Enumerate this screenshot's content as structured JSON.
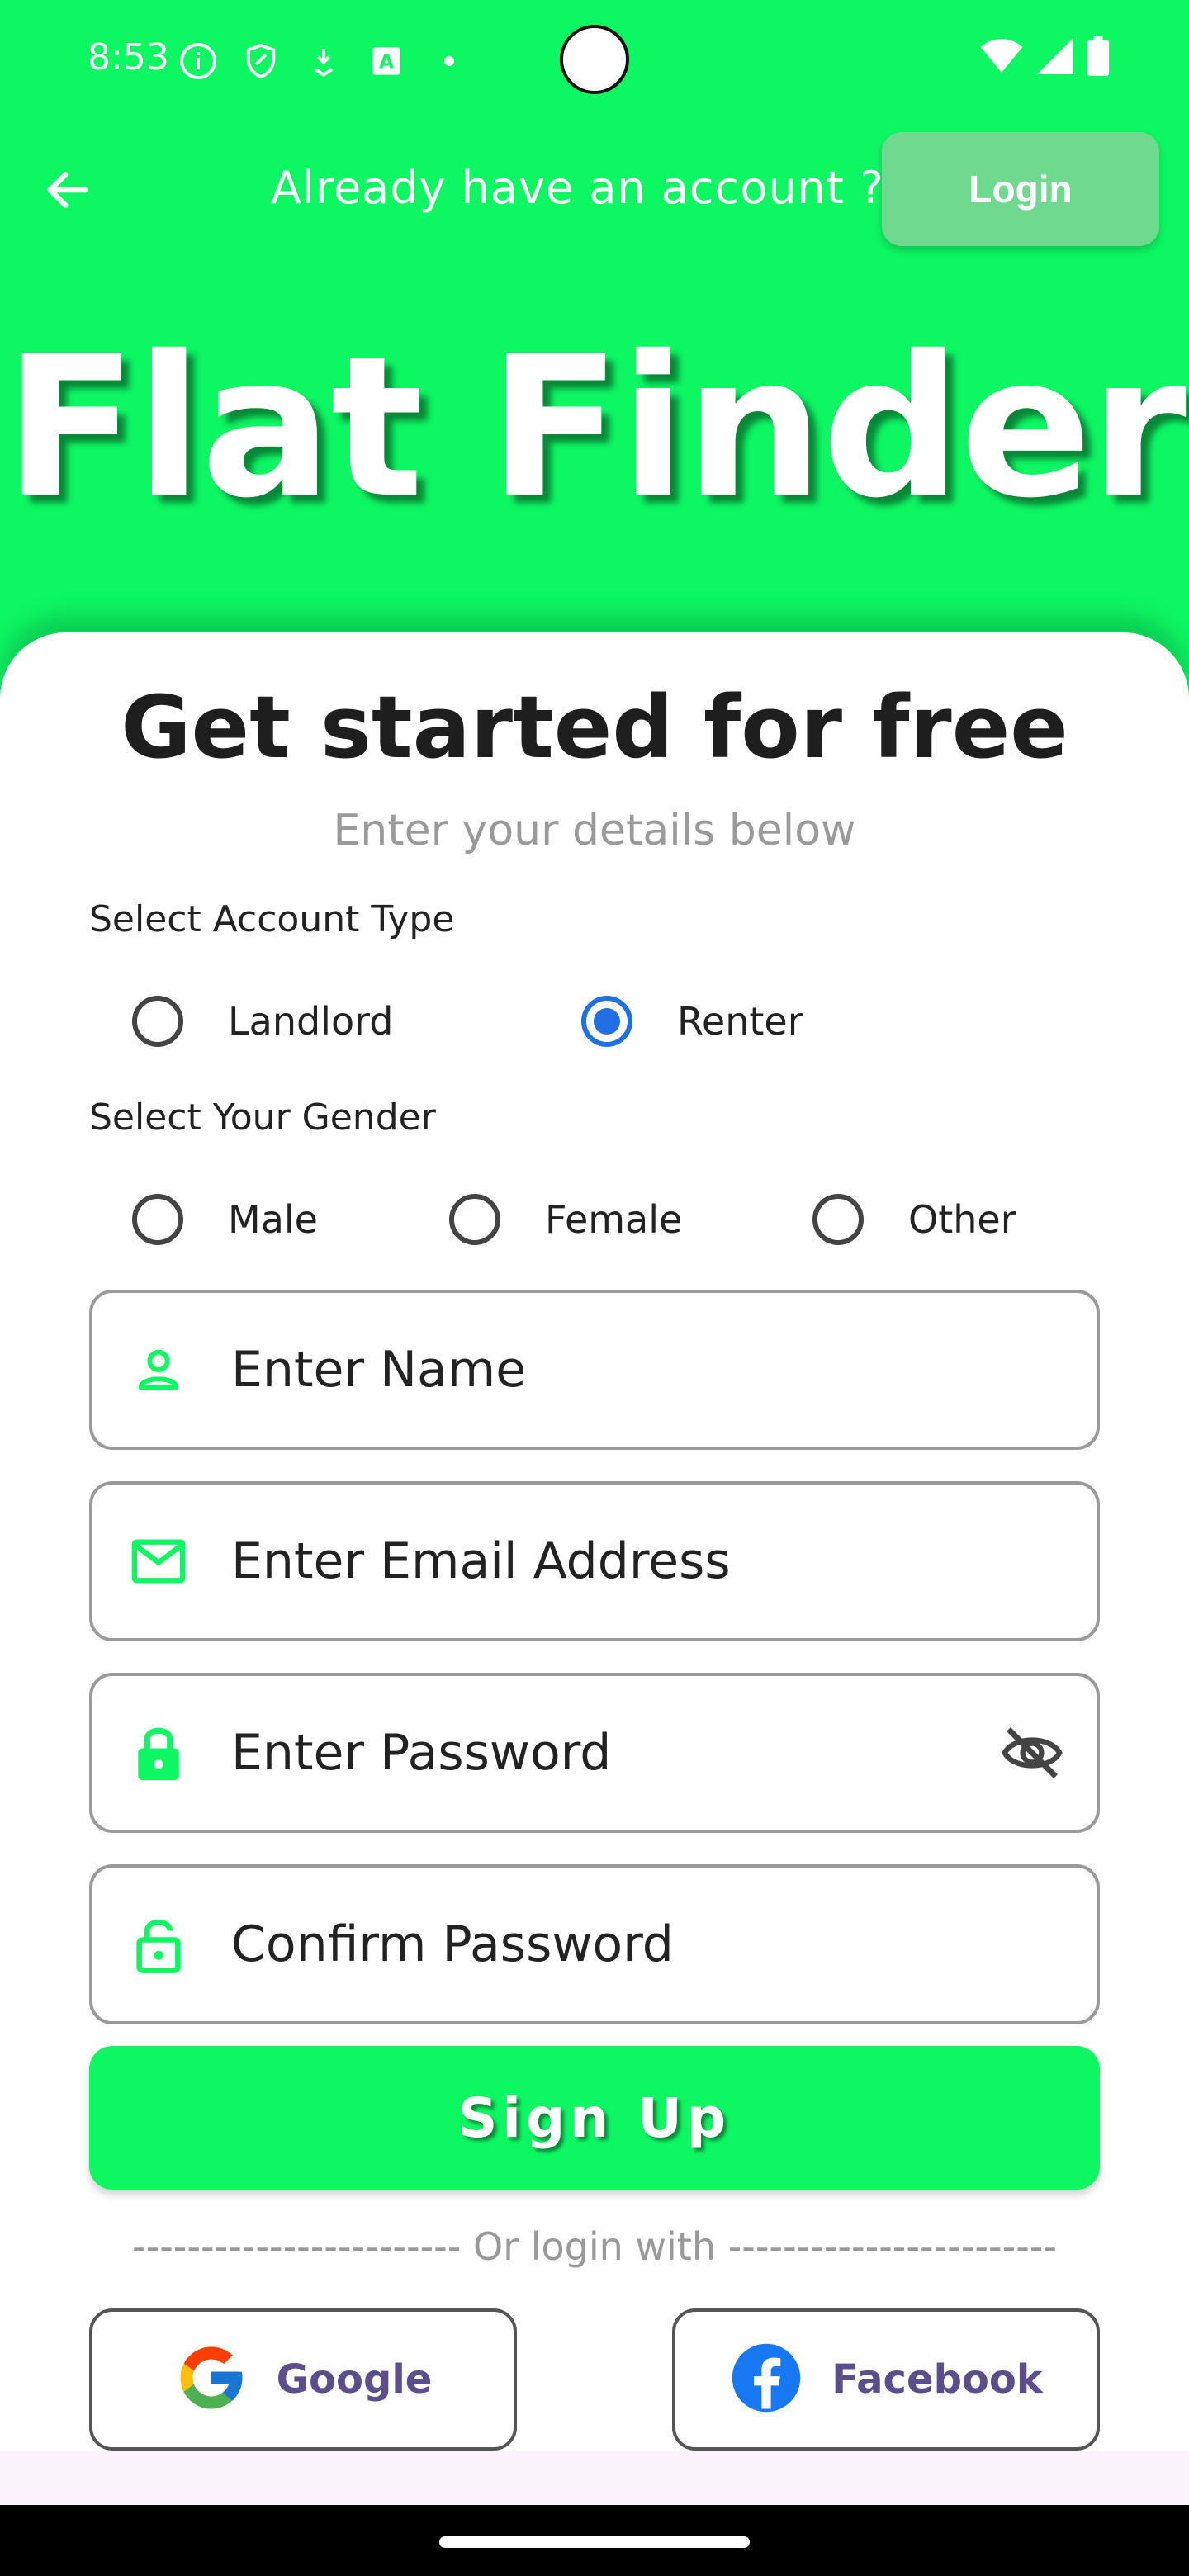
{
  "status_bar": {
    "time": "8:53",
    "icons_left": [
      "info-icon",
      "shield-icon",
      "download-icon",
      "font-icon",
      "dot-icon"
    ],
    "icons_right": [
      "wifi-icon",
      "signal-icon",
      "battery-icon"
    ]
  },
  "header": {
    "already_text": "Already have an account ?",
    "login_label": "Login"
  },
  "app_title": "Flat Finder",
  "form": {
    "heading": "Get started for free",
    "subheading": "Enter your details below",
    "account_type_label": "Select Account Type",
    "account_types": [
      {
        "label": "Landlord",
        "selected": false
      },
      {
        "label": "Renter",
        "selected": true
      }
    ],
    "gender_label": "Select Your Gender",
    "genders": [
      {
        "label": "Male",
        "selected": false
      },
      {
        "label": "Female",
        "selected": false
      },
      {
        "label": "Other",
        "selected": false
      }
    ],
    "name_placeholder": "Enter Name",
    "email_placeholder": "Enter Email Address",
    "password_placeholder": "Enter Password",
    "confirm_placeholder": "Confirm Password",
    "signup_label": "Sign Up",
    "or_login": "------------------------ Or login with ------------------------",
    "google_label": "Google",
    "facebook_label": "Facebook"
  },
  "colors": {
    "brand_green": "#0DF763",
    "login_button": "#6FD98F",
    "radio_selected": "#1F6FE5",
    "social_text": "#5C4E8C"
  }
}
